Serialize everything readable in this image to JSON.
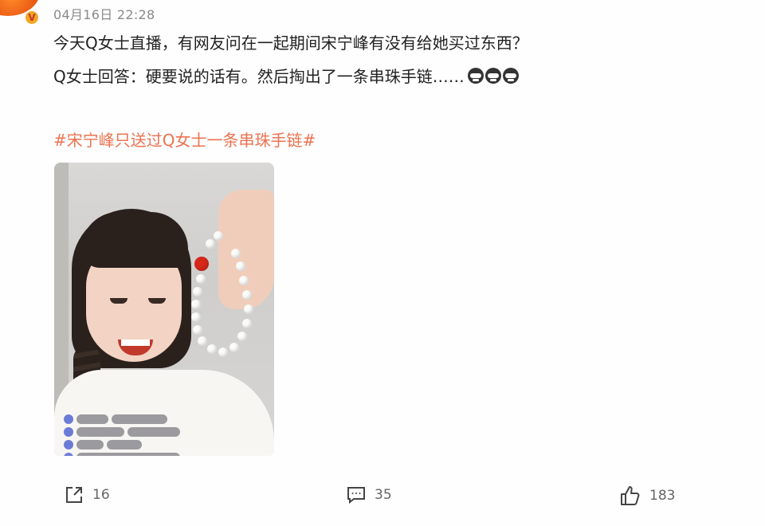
{
  "post": {
    "timestamp": "04月16日 22:28",
    "author_badge": "V",
    "lines": [
      "今天Q女士直播，有网友问在一起期间宋宁峰有没有给她买过东西？",
      "Q女士回答：硬要说的话有。然后掏出了一条串珠手链……"
    ],
    "emoji_icons": [
      "laughing-cry-emoji-icon",
      "laughing-cry-emoji-icon",
      "laughing-cry-emoji-icon"
    ],
    "hashtag": "#宋宁峰只送过Q女士一条串珠手链#",
    "hashtag_color": "#eb7350"
  },
  "actions": {
    "share": {
      "icon": "share-icon",
      "count": "16"
    },
    "comment": {
      "icon": "comment-icon",
      "count": "35"
    },
    "like": {
      "icon": "thumbs-up-icon",
      "count": "183"
    }
  }
}
